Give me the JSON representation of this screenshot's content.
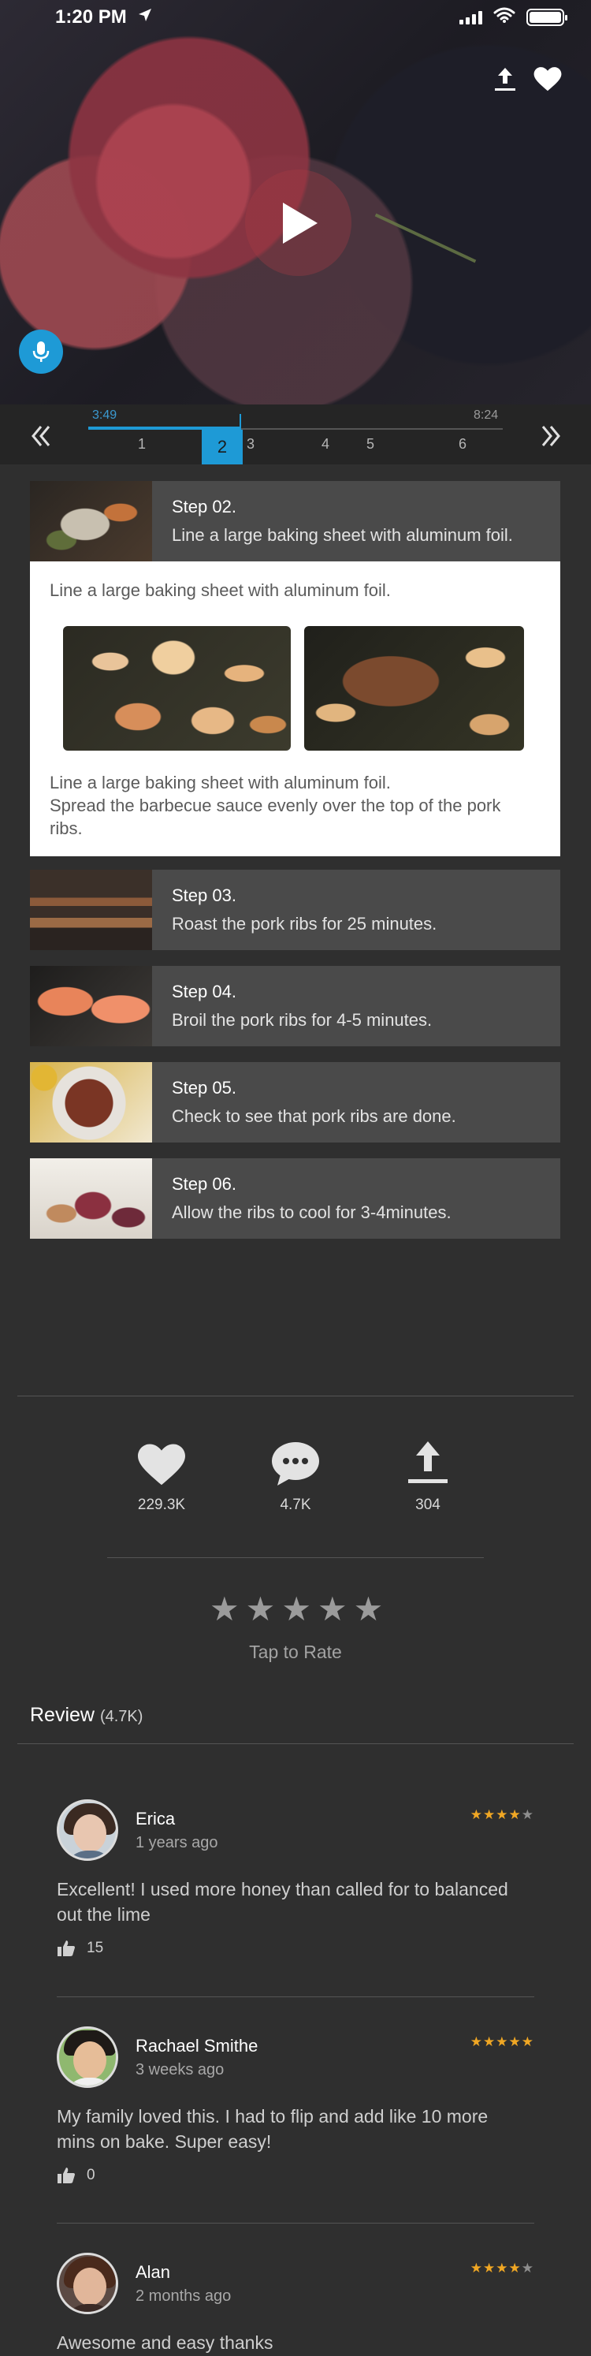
{
  "status_bar": {
    "time": "1:20 PM"
  },
  "timeline": {
    "start_time": "3:49",
    "end_time": "8:24",
    "steps": [
      "1",
      "2",
      "3",
      "4",
      "5",
      "6"
    ],
    "active_step": "2",
    "progress_fraction": 0.37
  },
  "steps": [
    {
      "title": "Step 02.",
      "description": "Line a large baking sheet with aluminum foil."
    },
    {
      "title": "Step 03.",
      "description": "Roast the pork ribs for 25 minutes."
    },
    {
      "title": "Step 04.",
      "description": "Broil the pork ribs for 4-5 minutes."
    },
    {
      "title": "Step 05.",
      "description": "Check to see that pork ribs are done."
    },
    {
      "title": "Step 06.",
      "description": "Allow the ribs to cool for 3-4minutes."
    }
  ],
  "step_detail": {
    "text1": "Line a large baking sheet with aluminum foil.",
    "text2_line1": "Line a large baking sheet with aluminum foil.",
    "text2_line2": "Spread the barbecue sauce evenly over the top of the pork ribs."
  },
  "actions": {
    "likes": "229.3K",
    "comments": "4.7K",
    "shares": "304"
  },
  "rating": {
    "tap_to_rate": "Tap to Rate",
    "star": "★"
  },
  "reviews_section": {
    "heading": "Review",
    "count": "(4.7K)"
  },
  "reviews": [
    {
      "name": "Erica",
      "time": "1 years ago",
      "rating": 4,
      "stars_on": "★★★★",
      "stars_off": "★",
      "text": "Excellent! I used more honey than called for  to balanced out the lime",
      "likes": "15"
    },
    {
      "name": "Rachael Smithe",
      "time": "3 weeks ago",
      "rating": 5,
      "stars_on": "★★★★★",
      "stars_off": "",
      "text": "My family loved this. I had to flip and add like 10 more mins on bake. Super easy!",
      "likes": "0"
    },
    {
      "name": "Alan",
      "time": "2 months ago",
      "rating": 4,
      "stars_on": "★★★★",
      "stars_off": "★",
      "text": "Awesome and easy thanks"
    }
  ],
  "colors": {
    "accent": "#1e9ad6",
    "star": "#f0a724",
    "background": "#2f2f2f",
    "card": "#4a4a4a"
  },
  "icons": [
    "location-arrow-icon",
    "signal-icon",
    "wifi-icon",
    "battery-icon",
    "share-icon",
    "heart-icon",
    "play-icon",
    "microphone-icon",
    "double-chevron-left-icon",
    "double-chevron-right-icon",
    "comment-icon",
    "star-icon",
    "thumbs-up-icon"
  ]
}
